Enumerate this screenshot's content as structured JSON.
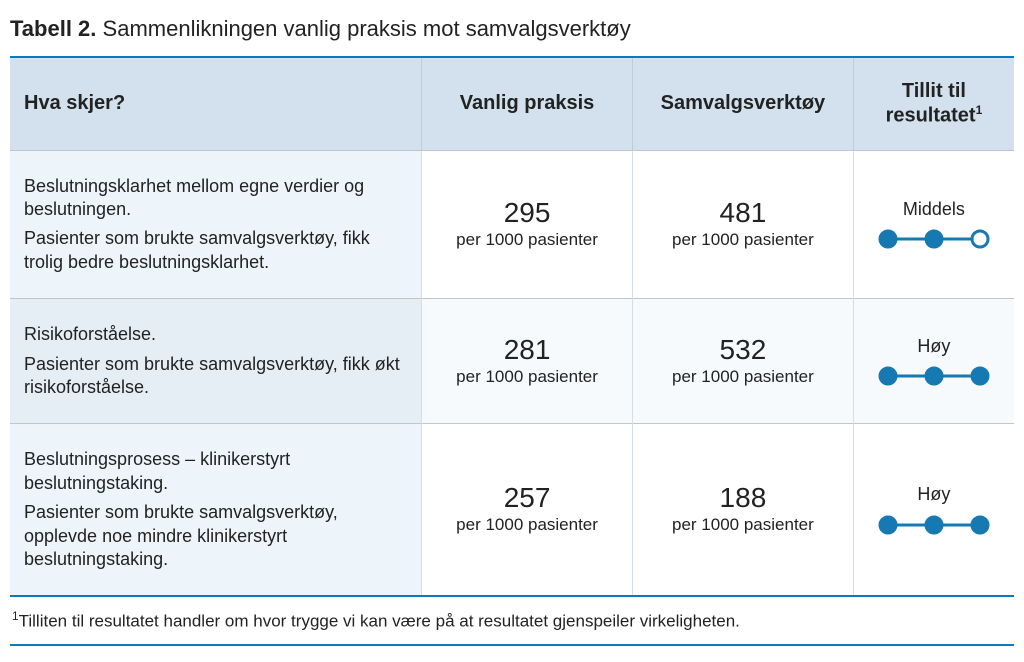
{
  "title_prefix": "Tabell 2.",
  "title_rest": "Sammenlikningen vanlig praksis mot samvalgsverktøy",
  "headers": {
    "what": "Hva skjer?",
    "standard": "Vanlig praksis",
    "tool": "Samvalgsverktøy",
    "trust": "Tillit til resultatet",
    "trust_sup": "1"
  },
  "per_unit": "per 1000 pasienter",
  "rows": [
    {
      "lead": "Beslutningsklarhet mellom egne verdier og beslutningen.",
      "detail": "Pasienter som brukte samvalgsverktøy, fikk trolig bedre beslutningsklarhet.",
      "standard": "295",
      "tool": "481",
      "trust": "Middels",
      "level": 2
    },
    {
      "lead": "Risikoforståelse.",
      "detail": "Pasienter som brukte samvalgsverktøy, fikk økt risikoforståelse.",
      "standard": "281",
      "tool": "532",
      "trust": "Høy",
      "level": 3
    },
    {
      "lead": "Beslutningsprosess – klinikerstyrt beslutningstaking.",
      "detail": "Pasienter som brukte samvalgsverktøy, opplevde noe mindre klinikerstyrt beslutningstaking.",
      "standard": "257",
      "tool": "188",
      "trust": "Høy",
      "level": 3
    }
  ],
  "footnote_sup": "1",
  "footnote": "Tilliten til resultatet handler om hvor trygge vi kan være på at resultatet gjenspeiler virkeligheten.",
  "chart_data": {
    "type": "table",
    "title": "Sammenlikningen vanlig praksis mot samvalgsverktøy",
    "unit": "per 1000 pasienter",
    "categories": [
      "Beslutningsklarhet",
      "Risikoforståelse",
      "Beslutningsprosess – klinikerstyrt"
    ],
    "series": [
      {
        "name": "Vanlig praksis",
        "values": [
          295,
          281,
          257
        ]
      },
      {
        "name": "Samvalgsverktøy",
        "values": [
          481,
          532,
          188
        ]
      }
    ],
    "trust_scale_max": 3,
    "trust": [
      {
        "label": "Middels",
        "value": 2
      },
      {
        "label": "Høy",
        "value": 3
      },
      {
        "label": "Høy",
        "value": 3
      }
    ]
  }
}
